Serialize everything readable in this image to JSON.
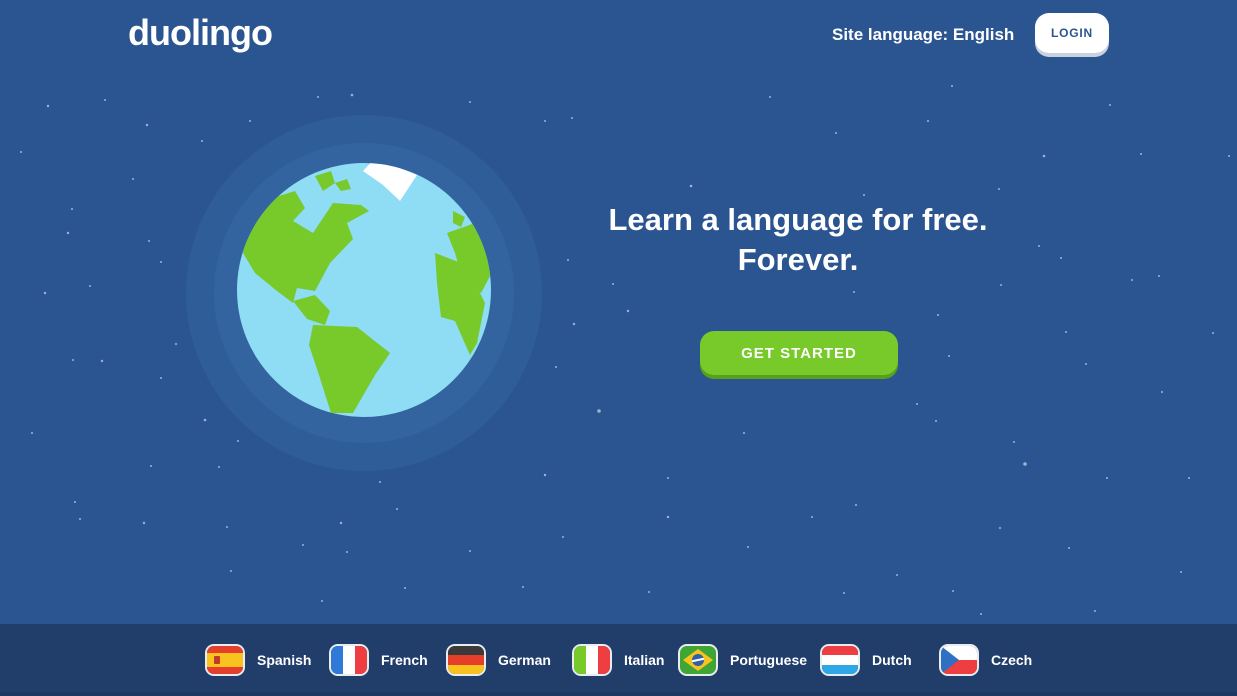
{
  "header": {
    "logo_text": "duolingo",
    "site_language_label": "Site language: English",
    "login_label": "LOGIN"
  },
  "hero": {
    "title_line1": "Learn a language for free.",
    "title_line2": "Forever.",
    "cta_label": "GET STARTED"
  },
  "languages": [
    {
      "label": "Spanish",
      "flag": "spain-flag-icon"
    },
    {
      "label": "French",
      "flag": "france-flag-icon"
    },
    {
      "label": "German",
      "flag": "germany-flag-icon"
    },
    {
      "label": "Italian",
      "flag": "italy-flag-icon"
    },
    {
      "label": "Portuguese",
      "flag": "brazil-flag-icon"
    },
    {
      "label": "Dutch",
      "flag": "netherlands-flag-icon"
    },
    {
      "label": "Czech",
      "flag": "czech-flag-icon"
    }
  ],
  "colors": {
    "background": "#2b5591",
    "language_bar": "#213e6a",
    "cta": "#78c92a",
    "ocean": "#8fdcf5",
    "land": "#78c92a"
  }
}
